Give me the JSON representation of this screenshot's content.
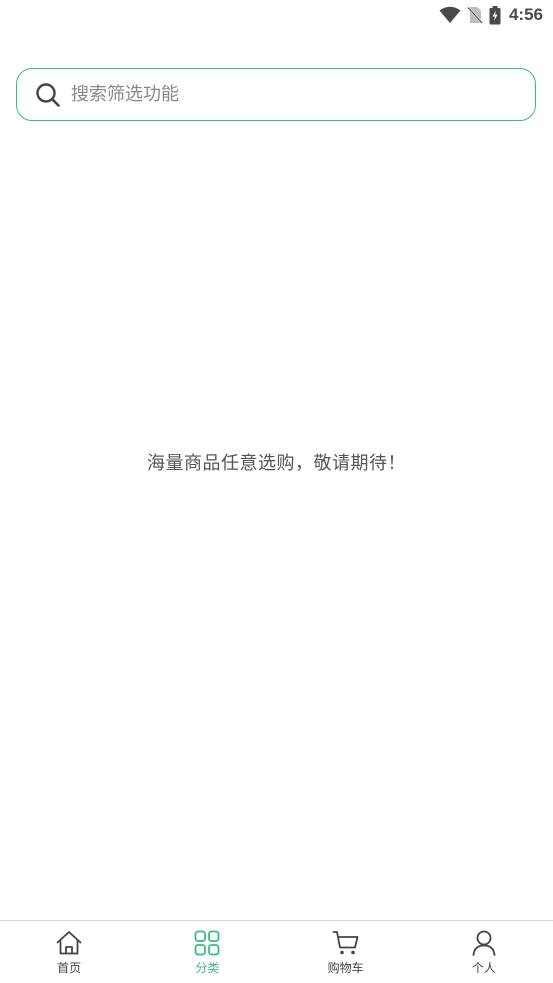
{
  "status_bar": {
    "time": "4:56",
    "icons": [
      "wifi-icon",
      "no-sim-icon",
      "battery-charging-icon"
    ]
  },
  "search": {
    "placeholder": "搜索筛选功能",
    "value": "",
    "icon": "search-icon"
  },
  "main": {
    "empty_message": "海量商品任意选购，敬请期待！"
  },
  "bottom_nav": {
    "active_index": 1,
    "items": [
      {
        "label": "首页",
        "icon": "home-icon"
      },
      {
        "label": "分类",
        "icon": "category-grid-icon"
      },
      {
        "label": "购物车",
        "icon": "cart-icon"
      },
      {
        "label": "个人",
        "icon": "user-icon"
      }
    ]
  },
  "colors": {
    "accent": "#3dba7e",
    "text": "#333333",
    "muted": "#888888",
    "divider": "#d6d6d6"
  }
}
